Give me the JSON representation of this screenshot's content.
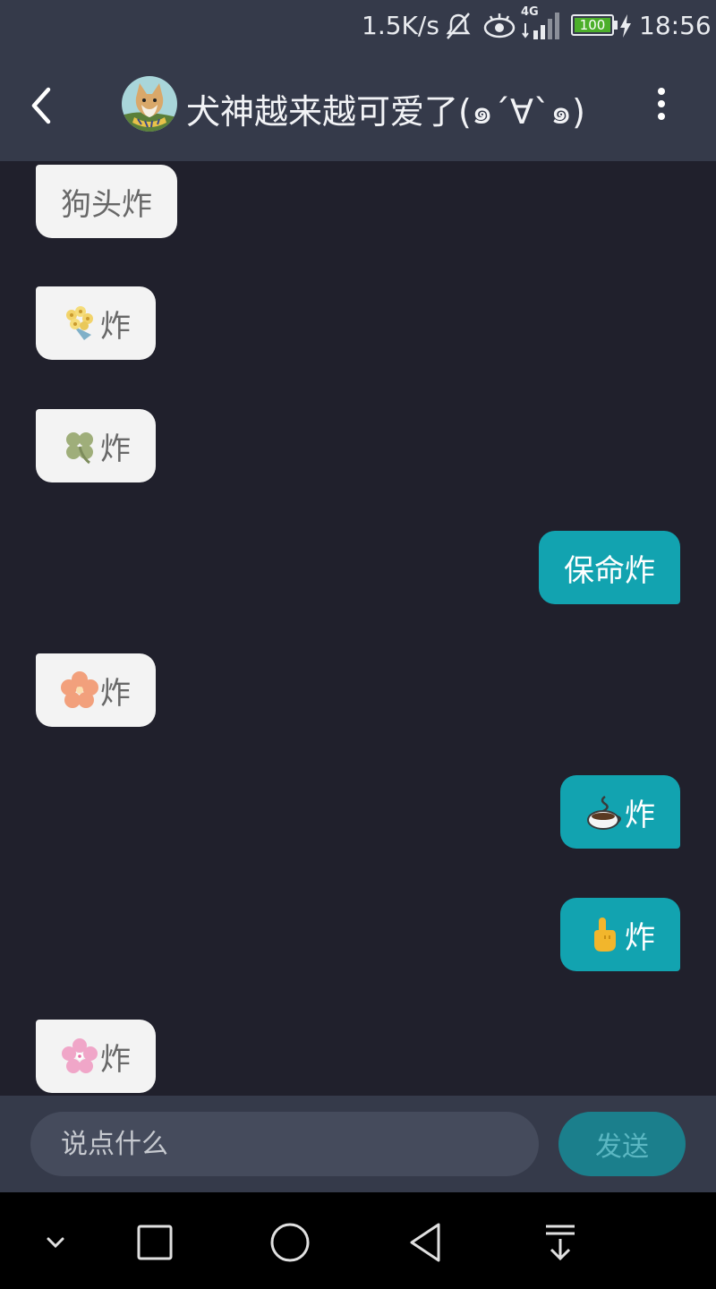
{
  "status_bar": {
    "network_speed": "1.5K/s",
    "network_type": "4G",
    "battery": "100",
    "time": "18:56"
  },
  "header": {
    "title": "犬神越来越可爱了(๑´∀`๑)"
  },
  "messages": [
    {
      "side": "left",
      "emoji": "",
      "text": "狗头炸"
    },
    {
      "side": "left",
      "emoji": "bouquet",
      "text": "炸"
    },
    {
      "side": "left",
      "emoji": "four-leaf-clover",
      "text": "炸"
    },
    {
      "side": "right",
      "emoji": "",
      "text": "保命炸"
    },
    {
      "side": "left",
      "emoji": "hibiscus",
      "text": "炸"
    },
    {
      "side": "right",
      "emoji": "hot-beverage",
      "text": "炸"
    },
    {
      "side": "right",
      "emoji": "pointing-up-hand",
      "text": "炸"
    },
    {
      "side": "left",
      "emoji": "cherry-blossom",
      "text": "炸"
    }
  ],
  "composer": {
    "placeholder": "说点什么",
    "value": "",
    "send_label": "发送"
  },
  "colors": {
    "background": "#20202c",
    "bar": "#353a4a",
    "outgoing_bubble": "#12a3b0",
    "incoming_bubble": "#f3f3f3",
    "send_button": "#1b7f8c"
  }
}
